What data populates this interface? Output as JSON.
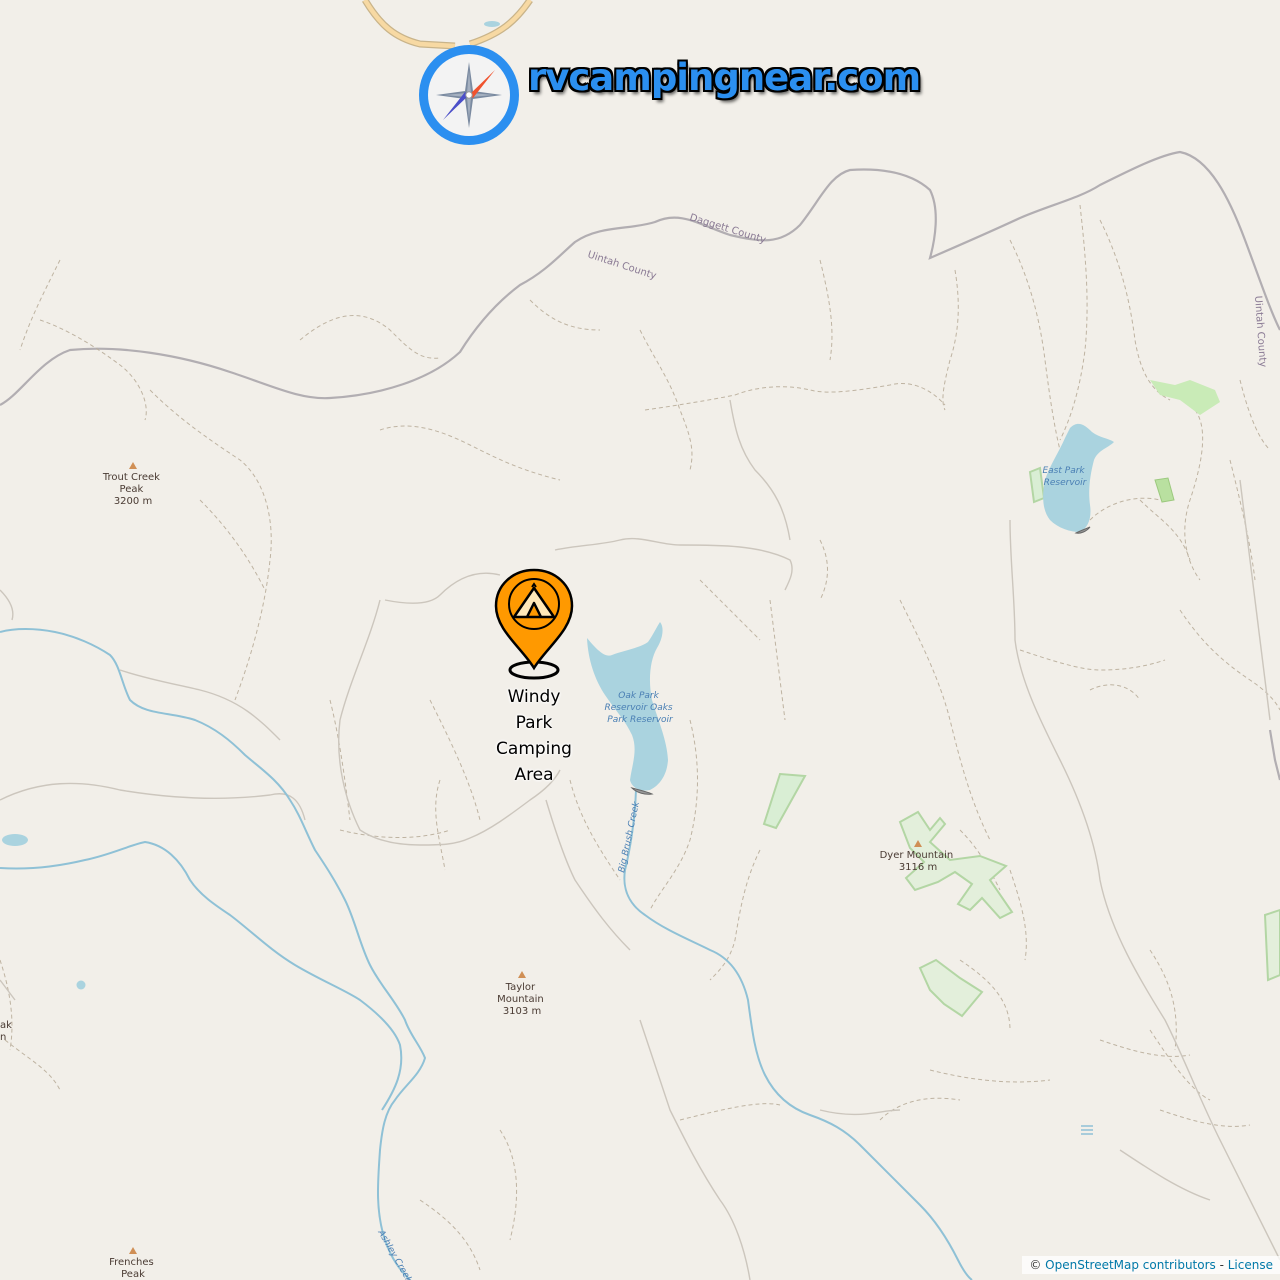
{
  "brand": {
    "site_name": "rvcampingnear.com",
    "icon": "compass-icon"
  },
  "campground": {
    "name": "Windy Park Camping Area",
    "name_lines": [
      "Windy",
      "Park",
      "Camping",
      "Area"
    ],
    "icon": "tent-marker-icon",
    "marker_color": "#ff9900"
  },
  "peaks": [
    {
      "name_lines": [
        "Trout Creek",
        "Peak"
      ],
      "elevation": "3200 m"
    },
    {
      "name_lines": [
        "Dyer Mountain"
      ],
      "elevation": "3116 m"
    },
    {
      "name_lines": [
        "Taylor",
        "Mountain"
      ],
      "elevation": "3103 m"
    },
    {
      "name_lines": [
        "Frenches",
        "Peak"
      ],
      "elevation": ""
    }
  ],
  "partial_labels": {
    "left_edge_peak": "ak",
    "left_edge_elev": "n"
  },
  "boundaries": {
    "daggett": "Daggett County",
    "uintah": "Uintah County",
    "uintah_east": "Uintah County"
  },
  "water": {
    "oak_park": [
      "Oak Park",
      "Reservoir Oaks",
      "Park Reservoir"
    ],
    "east_park": [
      "East Park",
      "Reservoir"
    ],
    "big_brush_creek": "Big Brush Creek",
    "ashley_creek": "Ashley Creek"
  },
  "attribution": {
    "prefix": "©",
    "osm": "OpenStreetMap contributors",
    "separator": " - ",
    "license": "License"
  },
  "colors": {
    "land": "#f2efe9",
    "water": "#aad3df",
    "stream": "#8fc1d6",
    "boundary": "#9e9e9e",
    "brand_blue": "#2b8ff0",
    "marker_orange": "#ff9900"
  }
}
